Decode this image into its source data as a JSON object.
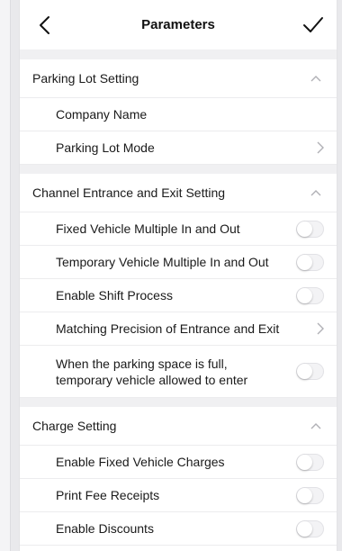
{
  "nav": {
    "title": "Parameters"
  },
  "sections": [
    {
      "title": "Parking Lot Setting",
      "rows": [
        {
          "label": "Company Name",
          "control": "none"
        },
        {
          "label": "Parking Lot Mode",
          "control": "chevron"
        }
      ]
    },
    {
      "title": "Channel Entrance and Exit Setting",
      "rows": [
        {
          "label": "Fixed Vehicle Multiple In and Out",
          "control": "toggle",
          "on": false
        },
        {
          "label": "Temporary Vehicle Multiple In and Out",
          "control": "toggle",
          "on": false
        },
        {
          "label": "Enable Shift Process",
          "control": "toggle",
          "on": false
        },
        {
          "label": "Matching Precision of Entrance and Exit",
          "control": "chevron"
        },
        {
          "label_line1": "When the parking space is full,",
          "label_line2": "temporary vehicle allowed to enter",
          "control": "toggle",
          "on": false
        }
      ]
    },
    {
      "title": "Charge Setting",
      "rows": [
        {
          "label": "Enable Fixed Vehicle Charges",
          "control": "toggle",
          "on": false
        },
        {
          "label": "Print Fee Receipts",
          "control": "toggle",
          "on": false
        },
        {
          "label": "Enable Discounts",
          "control": "toggle",
          "on": false
        }
      ]
    }
  ],
  "colors": {
    "background": "#f0f0f2",
    "divider": "#ececee",
    "toggle_off": "#f3f3f5"
  }
}
